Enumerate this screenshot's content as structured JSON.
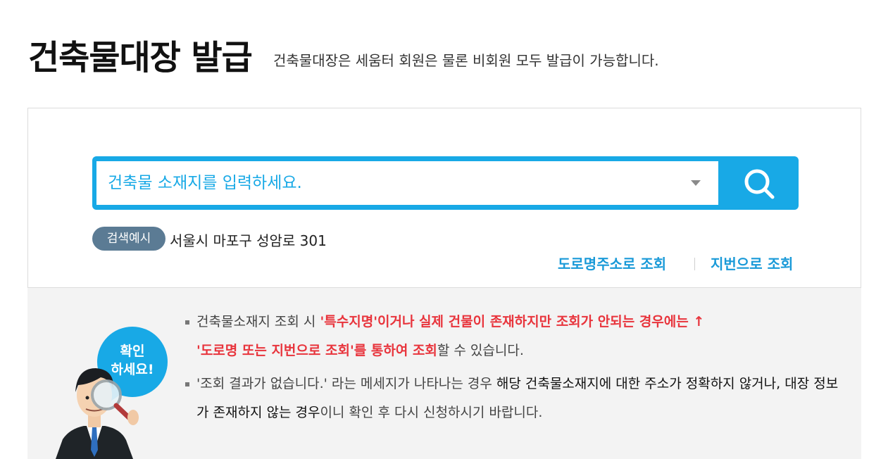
{
  "header": {
    "title": "건축물대장 발급",
    "subtitle": "건축물대장은 세움터 회원은 물론 비회원 모두 발급이 가능합니다."
  },
  "search": {
    "placeholder": "건축물 소재지를 입력하세요.",
    "value": "",
    "dropdown_icon": "caret-down-icon",
    "button_icon": "search-icon",
    "example_badge": "검색예시",
    "example_text": "서울시 마포구 성암로 301"
  },
  "links": {
    "road": "도로명주소로 조회",
    "lot": "지번으로 조회"
  },
  "mascot": {
    "bubble_line1": "확인",
    "bubble_line2": "하세요!",
    "icon": "man-with-magnifier-icon"
  },
  "notices": [
    {
      "part1": "건축물소재지 조회 시 ",
      "part2": "'특수지명'이거나 실제 건물이 존재하지만 조회가 안되는 경우에는 ↑",
      "part3": "'도로명 또는 지번으로 조회'를 통하여 조회",
      "part4": "할 수 있습니다."
    },
    {
      "part1": "'조회 결과가 없습니다.' 라는 메세지가 나타나는 경우 ",
      "part2": "해당 건축물소재지에 대한 주소가 정확하지 않거나, 대장 정보가 존재하지 않는 경우",
      "part3": "이니 확인 후 다시 신청하시기 바랍니다."
    }
  ],
  "colors": {
    "accent": "#18a9e6",
    "link": "#1a9ad8",
    "badge": "#5b7b94",
    "highlight_red": "#e8343c",
    "notice_bg": "#f3f3f3"
  }
}
